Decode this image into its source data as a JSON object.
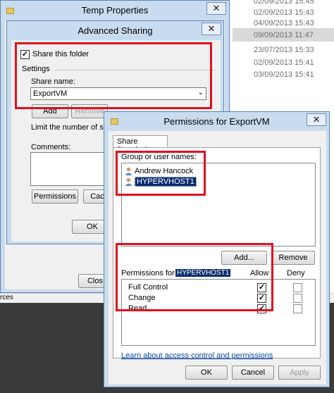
{
  "background": {
    "dates": [
      "02/09/2013 15:45",
      "02/09/2013 15:43",
      "04/09/2013 15:43",
      "09/09/2013 11:47",
      "23/07/2013 15:33",
      "02/09/2013 15:41",
      "03/09/2013 15:41"
    ],
    "strip_text": "rces"
  },
  "temp_props": {
    "title": "Temp Properties",
    "close_label": "Clos"
  },
  "advanced": {
    "title": "Advanced Sharing",
    "share_checkbox": "Share this folder",
    "settings_group": "Settings",
    "share_name_label": "Share name:",
    "share_name_value": "ExportVM",
    "add_button": "Add",
    "remove_button": "Remove",
    "limit_text": "Limit the number of simult",
    "comments_label": "Comments:",
    "permissions_button": "Permissions",
    "caching_button": "Cac",
    "ok_button": "OK"
  },
  "permissions": {
    "title": "Permissions for ExportVM",
    "tab": "Share Permissions",
    "group_label": "Group or user names:",
    "users": [
      "Andrew Hancock",
      "HYPERVHOST1"
    ],
    "add_button": "Add...",
    "remove_button": "Remove",
    "perm_label": "Permissions for",
    "perm_user": "HYPERVHOST1",
    "allow_header": "Allow",
    "deny_header": "Deny",
    "rows": [
      {
        "name": "Full Control",
        "allow": "✓",
        "deny": ""
      },
      {
        "name": "Change",
        "allow": "✓",
        "deny": ""
      },
      {
        "name": "Read",
        "allow": "✓",
        "deny": ""
      }
    ],
    "learn_link": "Learn about access control and permissions",
    "ok_button": "OK",
    "cancel_button": "Cancel",
    "apply_button": "Apply"
  },
  "colors": {
    "highlight_box": "#e01020",
    "selection": "#0b2d6e",
    "frame": "#c9dcef"
  }
}
